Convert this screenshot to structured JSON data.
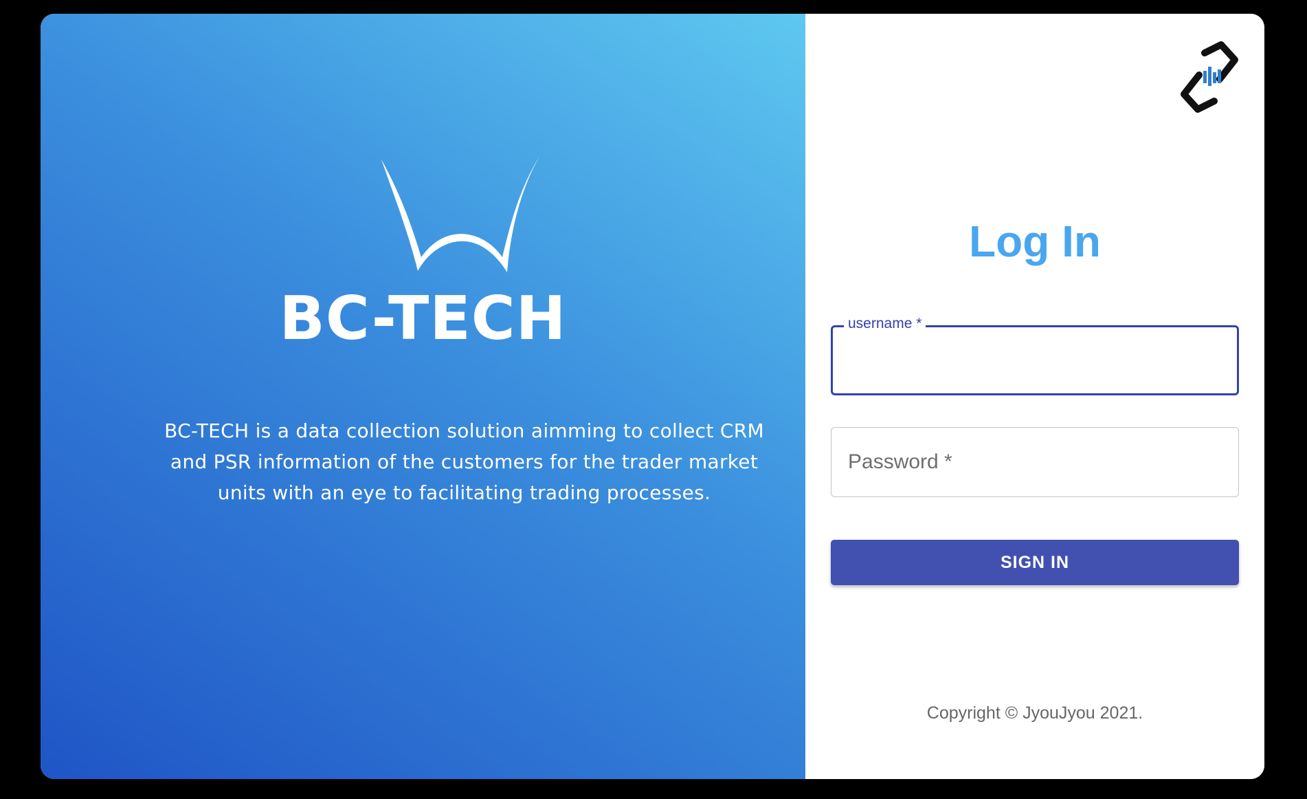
{
  "brand": {
    "name": "BC-TECH",
    "description": "BC-TECH is a data collection solution aimming to collect CRM and PSR information of the customers for the trader market units with an eye to facilitating trading processes.",
    "gradient_start": "#1f55c6",
    "gradient_end": "#5ec8f0",
    "logo_icon": "w-swoosh-logo-icon"
  },
  "login": {
    "title": "Log In",
    "title_color": "#4aa6ee",
    "username_label": "username *",
    "username_value": "",
    "password_placeholder": "Password *",
    "password_value": "",
    "signin_label": "SIGN IN",
    "accent_color": "#3441ad",
    "button_color": "#4250b0",
    "corner_logo_icon": "chain-link-logo-icon"
  },
  "footer": {
    "copyright": "Copyright © JyouJyou 2021."
  }
}
